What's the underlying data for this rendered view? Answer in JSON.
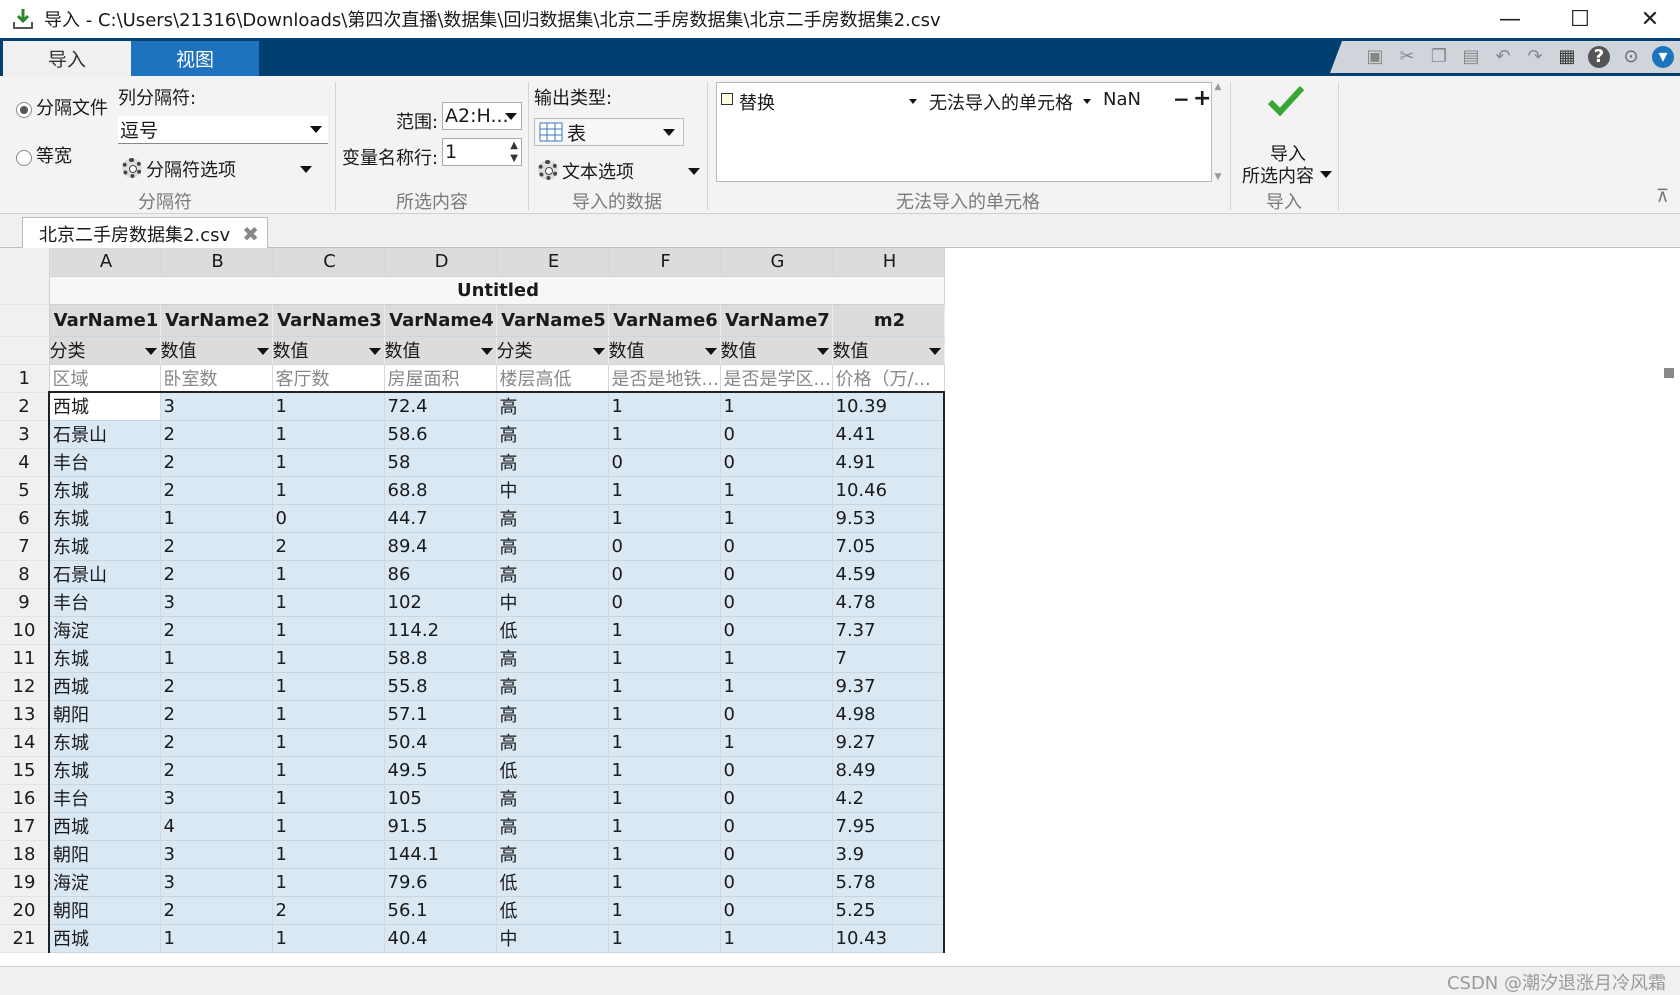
{
  "window": {
    "title": "导入 - C:\\Users\\21316\\Downloads\\第四次直播\\数据集\\回归数据集\\北京二手房数据集\\北京二手房数据集2.csv",
    "minimize": "—",
    "maximize": "☐",
    "close": "✕"
  },
  "tabs": {
    "import": "导入",
    "view": "视图"
  },
  "ribbon": {
    "delimited": "分隔文件",
    "fixed_width": "等宽",
    "column_delimiter_label": "列分隔符:",
    "column_delimiter_value": "逗号",
    "delimiter_options": "分隔符选项",
    "group_delimiter": "分隔符",
    "range_label": "范围:",
    "range_value": "A2:H...",
    "varname_row_label": "变量名称行:",
    "varname_row_value": "1",
    "group_selection": "所选内容",
    "output_type_label": "输出类型:",
    "output_type_value": "表",
    "text_options": "文本选项",
    "group_imported_data": "导入的数据",
    "rule_action": "替换",
    "rule_condition": "无法导入的单元格",
    "rule_value": "NaN",
    "minus": "−",
    "plus": "+",
    "group_unimportable": "无法导入的单元格",
    "import_btn_line1": "导入",
    "import_btn_line2": "所选内容",
    "group_import": "导入"
  },
  "doc_tab": {
    "label": "北京二手房数据集2.csv",
    "close": "✖"
  },
  "grid": {
    "columns": [
      "A",
      "B",
      "C",
      "D",
      "E",
      "F",
      "G",
      "H"
    ],
    "table_title": "Untitled",
    "var_names": [
      "VarName1",
      "VarName2",
      "VarName3",
      "VarName4",
      "VarName5",
      "VarName6",
      "VarName7",
      "m2"
    ],
    "types": [
      "分类",
      "数值",
      "数值",
      "数值",
      "分类",
      "数值",
      "数值",
      "数值"
    ],
    "header_row": [
      "区域",
      "卧室数",
      "客厅数",
      "房屋面积",
      "楼层高低",
      "是否是地铁...",
      "是否是学区...",
      "价格（万/..."
    ],
    "rows": [
      [
        "2",
        "西城",
        "3",
        "1",
        "72.4",
        "高",
        "1",
        "1",
        "10.39"
      ],
      [
        "3",
        "石景山",
        "2",
        "1",
        "58.6",
        "高",
        "1",
        "0",
        "4.41"
      ],
      [
        "4",
        "丰台",
        "2",
        "1",
        "58",
        "高",
        "0",
        "0",
        "4.91"
      ],
      [
        "5",
        "东城",
        "2",
        "1",
        "68.8",
        "中",
        "1",
        "1",
        "10.46"
      ],
      [
        "6",
        "东城",
        "1",
        "0",
        "44.7",
        "高",
        "1",
        "1",
        "9.53"
      ],
      [
        "7",
        "东城",
        "2",
        "2",
        "89.4",
        "高",
        "0",
        "0",
        "7.05"
      ],
      [
        "8",
        "石景山",
        "2",
        "1",
        "86",
        "高",
        "0",
        "0",
        "4.59"
      ],
      [
        "9",
        "丰台",
        "3",
        "1",
        "102",
        "中",
        "0",
        "0",
        "4.78"
      ],
      [
        "10",
        "海淀",
        "2",
        "1",
        "114.2",
        "低",
        "1",
        "0",
        "7.37"
      ],
      [
        "11",
        "东城",
        "1",
        "1",
        "58.8",
        "高",
        "1",
        "1",
        "7"
      ],
      [
        "12",
        "西城",
        "2",
        "1",
        "55.8",
        "高",
        "1",
        "1",
        "9.37"
      ],
      [
        "13",
        "朝阳",
        "2",
        "1",
        "57.1",
        "高",
        "1",
        "0",
        "4.98"
      ],
      [
        "14",
        "东城",
        "2",
        "1",
        "50.4",
        "高",
        "1",
        "1",
        "9.27"
      ],
      [
        "15",
        "东城",
        "2",
        "1",
        "49.5",
        "低",
        "1",
        "0",
        "8.49"
      ],
      [
        "16",
        "丰台",
        "3",
        "1",
        "105",
        "高",
        "1",
        "0",
        "4.2"
      ],
      [
        "17",
        "西城",
        "4",
        "1",
        "91.5",
        "高",
        "1",
        "0",
        "7.95"
      ],
      [
        "18",
        "朝阳",
        "3",
        "1",
        "144.1",
        "高",
        "1",
        "0",
        "3.9"
      ],
      [
        "19",
        "海淀",
        "3",
        "1",
        "79.6",
        "低",
        "1",
        "0",
        "5.78"
      ],
      [
        "20",
        "朝阳",
        "2",
        "2",
        "56.1",
        "低",
        "1",
        "0",
        "5.25"
      ],
      [
        "21",
        "西城",
        "1",
        "1",
        "40.4",
        "中",
        "1",
        "1",
        "10.43"
      ]
    ]
  },
  "watermark": "CSDN @潮汐退涨月冷风霜",
  "colors": {
    "tab_bar": "#003f6f",
    "selected_cell": "#dae8f4",
    "inactive_tab": "#1e73be",
    "check": "#3aa636"
  }
}
